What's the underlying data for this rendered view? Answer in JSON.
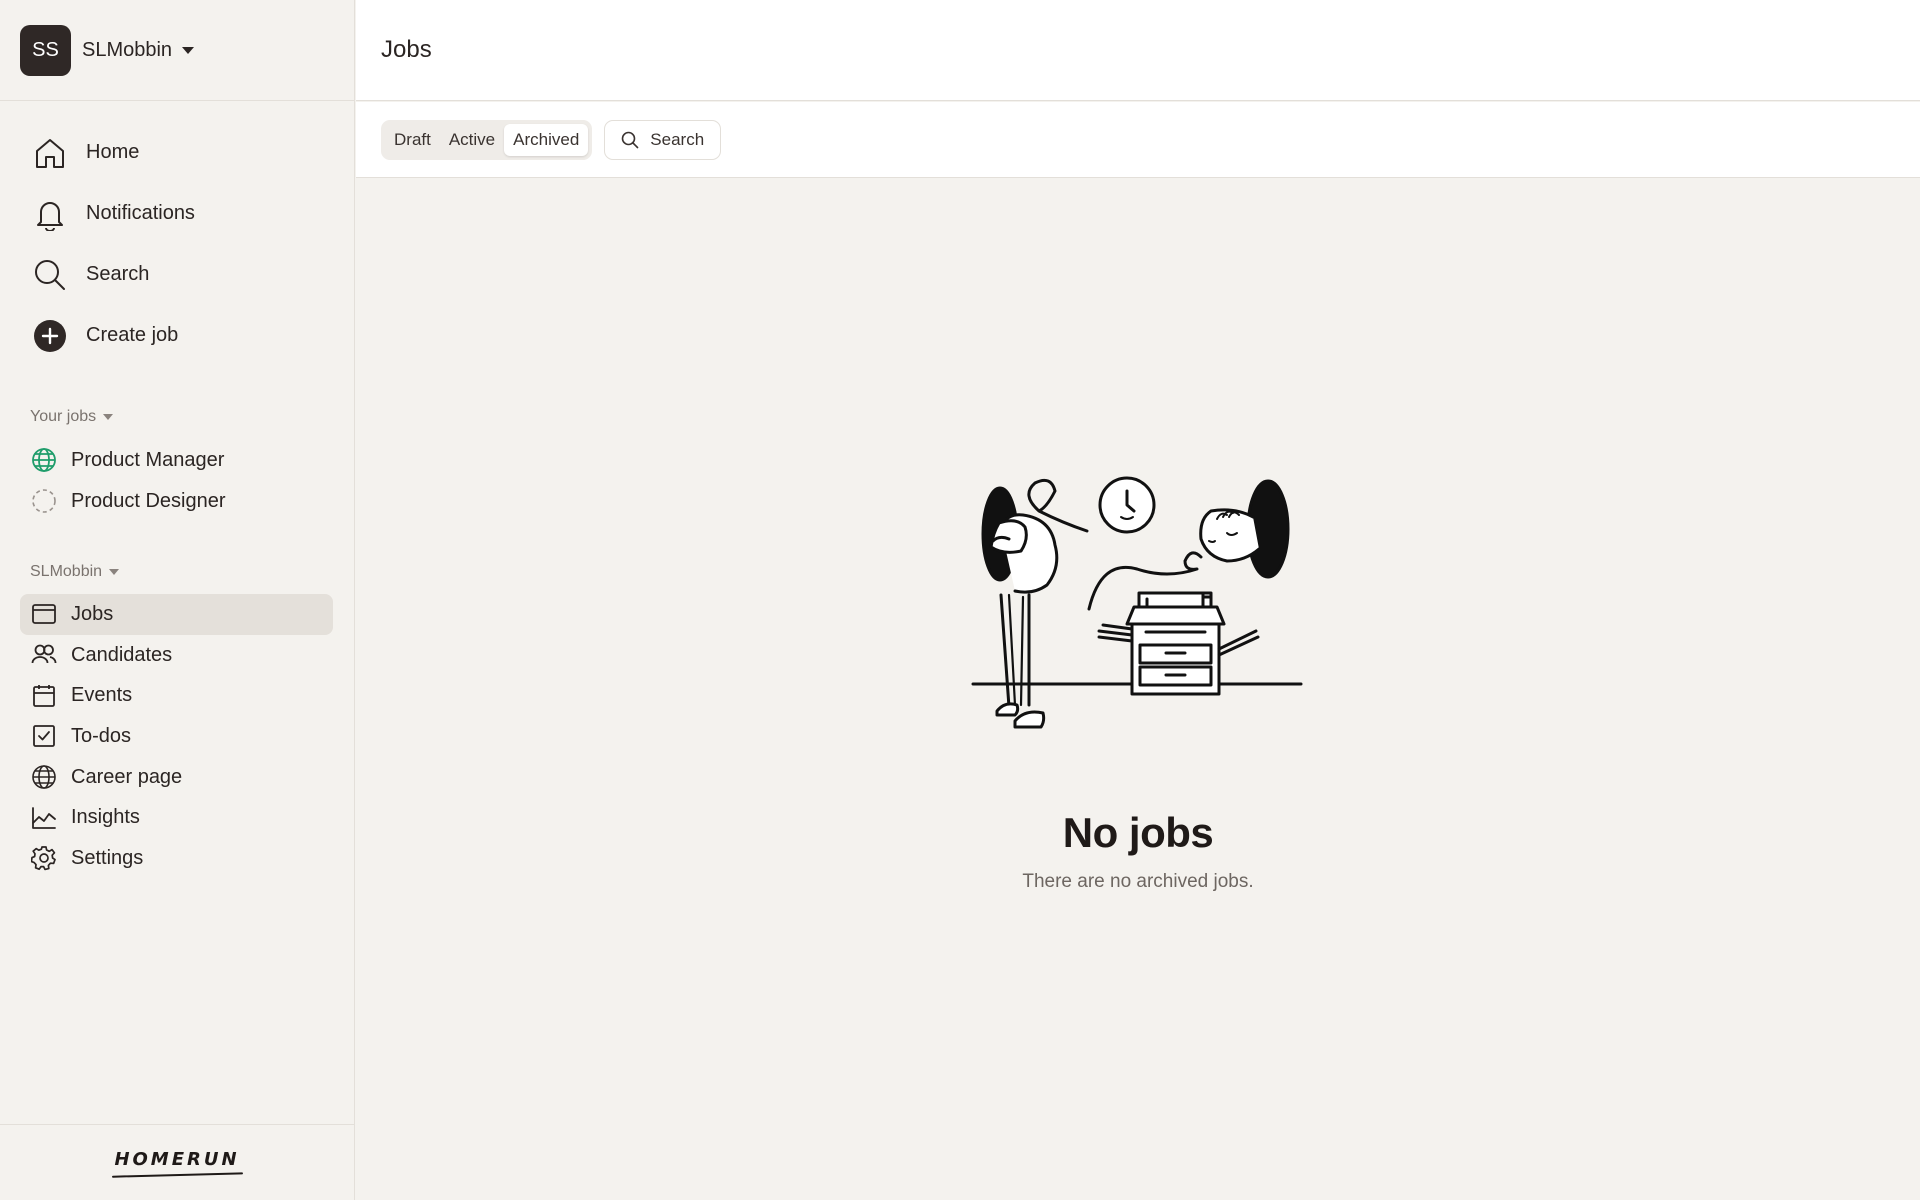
{
  "workspace": {
    "initials": "SS",
    "name": "SLMobbin"
  },
  "main_nav": [
    {
      "label": "Home",
      "icon": "home-icon"
    },
    {
      "label": "Notifications",
      "icon": "bell-icon"
    },
    {
      "label": "Search",
      "icon": "search-icon"
    },
    {
      "label": "Create job",
      "icon": "plus-circle-icon"
    }
  ],
  "your_jobs": {
    "label": "Your jobs",
    "items": [
      {
        "label": "Product Manager",
        "icon": "globe-green-icon"
      },
      {
        "label": "Product Designer",
        "icon": "dashed-circle-icon"
      }
    ]
  },
  "org": {
    "label": "SLMobbin",
    "items": [
      {
        "label": "Jobs",
        "icon": "window-icon",
        "active": true
      },
      {
        "label": "Candidates",
        "icon": "users-icon"
      },
      {
        "label": "Events",
        "icon": "calendar-icon"
      },
      {
        "label": "To-dos",
        "icon": "checkbox-icon"
      },
      {
        "label": "Career page",
        "icon": "globe-icon"
      },
      {
        "label": "Insights",
        "icon": "chart-icon"
      },
      {
        "label": "Settings",
        "icon": "gear-icon"
      }
    ]
  },
  "brand": {
    "logo_text": "HOMERUN"
  },
  "header": {
    "title": "Jobs"
  },
  "filters": {
    "tabs": [
      {
        "label": "Draft"
      },
      {
        "label": "Active"
      },
      {
        "label": "Archived",
        "active": true
      }
    ],
    "search_label": "Search"
  },
  "empty_state": {
    "title": "No jobs",
    "subtitle": "There are no archived jobs."
  },
  "colors": {
    "accent_dark": "#2f2826",
    "active_bg": "#e4e0da",
    "page_bg": "#f4f2ee",
    "globe_green": "#1f9d6b"
  }
}
